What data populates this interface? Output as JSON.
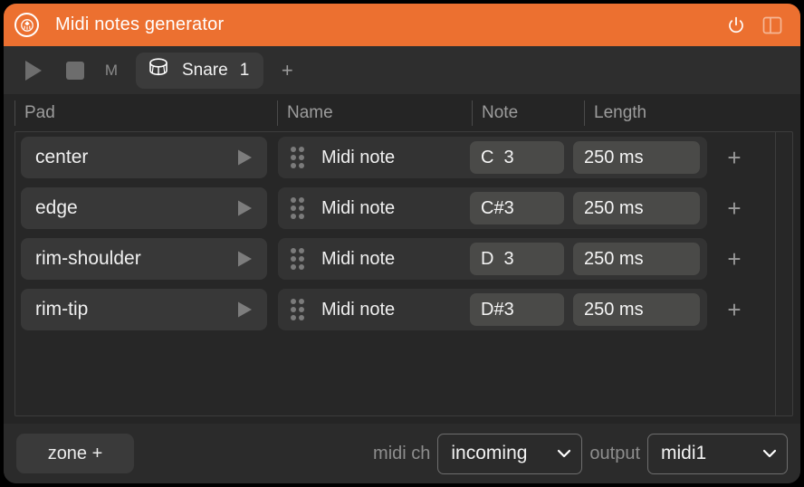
{
  "window": {
    "title": "Midi notes generator",
    "accent_color": "#ec7030",
    "titlebar_icons": {
      "logo": "app-logo-icon",
      "power": "power-icon",
      "panel": "panel-toggle-icon"
    }
  },
  "toolbar": {
    "play": "play-icon",
    "stop": "stop-icon",
    "metronome_label": "M",
    "kit_tab": {
      "icon": "drum-icon",
      "name": "Snare",
      "number": "1"
    },
    "add_label": "+"
  },
  "table": {
    "headers": {
      "pad": "Pad",
      "name": "Name",
      "note": "Note",
      "length": "Length"
    },
    "rows": [
      {
        "pad": "center",
        "name": "Midi note",
        "note": "C  3",
        "length": "250 ms",
        "add": "+"
      },
      {
        "pad": "edge",
        "name": "Midi note",
        "note": "C#3",
        "length": "250 ms",
        "add": "+"
      },
      {
        "pad": "rim-shoulder",
        "name": "Midi note",
        "note": "D  3",
        "length": "250 ms",
        "add": "+"
      },
      {
        "pad": "rim-tip",
        "name": "Midi note",
        "note": "D#3",
        "length": "250 ms",
        "add": "+"
      }
    ]
  },
  "bottom": {
    "zone_add_label": "zone +",
    "midi_ch_label": "midi ch",
    "midi_ch_value": "incoming",
    "output_label": "output",
    "output_value": "midi1"
  }
}
